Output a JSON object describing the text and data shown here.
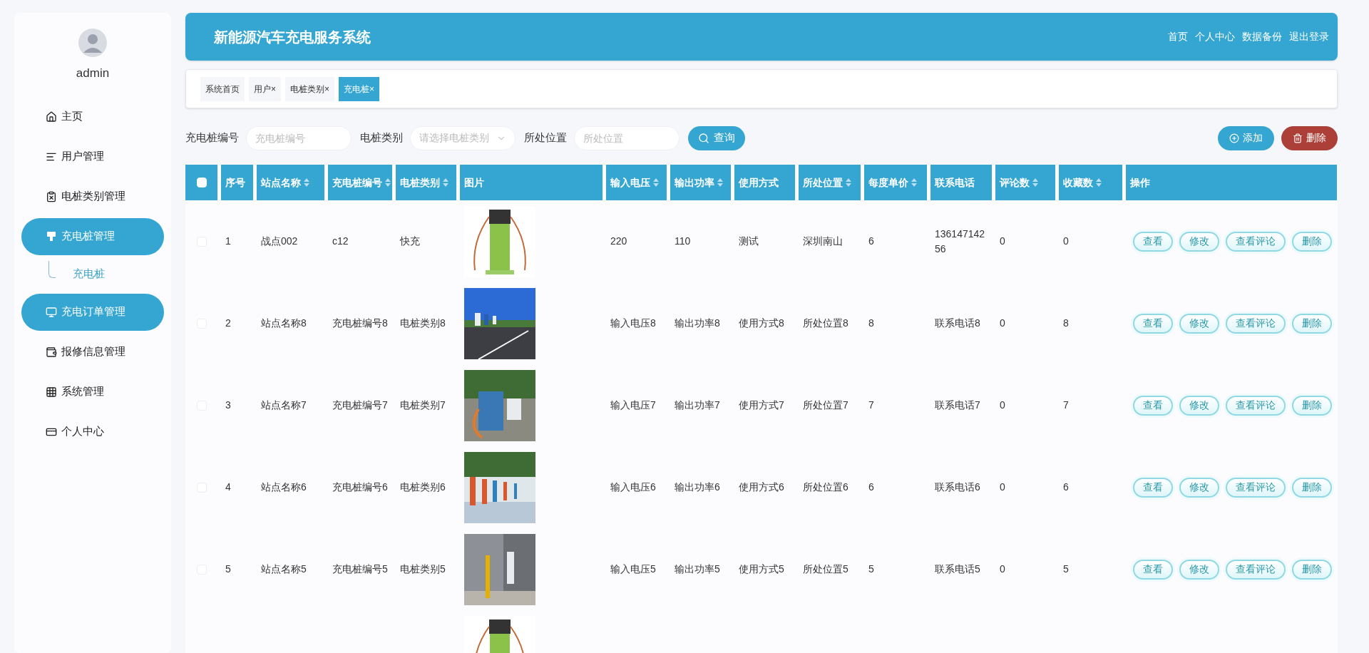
{
  "sidebar": {
    "user": "admin",
    "items": [
      {
        "label": "主页",
        "selected": false
      },
      {
        "label": "用户管理",
        "selected": false
      },
      {
        "label": "电桩类别管理",
        "selected": false
      },
      {
        "label": "充电桩管理",
        "selected": true,
        "children": [
          {
            "label": "充电桩",
            "selected": true
          }
        ]
      },
      {
        "label": "充电订单管理",
        "selected": true
      },
      {
        "label": "报修信息管理",
        "selected": false
      },
      {
        "label": "系统管理",
        "selected": false
      },
      {
        "label": "个人中心",
        "selected": false
      }
    ]
  },
  "header": {
    "title": "新能源汽车充电服务系统",
    "links": [
      "首页",
      "个人中心",
      "数据备份",
      "退出登录"
    ]
  },
  "tabs": [
    {
      "label": "系统首页",
      "selected": false
    },
    {
      "label": "用户",
      "close": "×",
      "selected": false
    },
    {
      "label": "电桩类别",
      "close": "×",
      "selected": false
    },
    {
      "label": "充电桩",
      "close": "×",
      "selected": true
    }
  ],
  "search": {
    "fields": [
      {
        "label": "充电桩编号",
        "kind": "input",
        "placeholder": "充电桩编号"
      },
      {
        "label": "电桩类别",
        "kind": "select",
        "placeholder": "请选择电桩类别"
      },
      {
        "label": "所处位置",
        "kind": "input",
        "placeholder": "所处位置"
      }
    ],
    "query_button": "查询",
    "add_button": "添加",
    "delete_button": "删除"
  },
  "table": {
    "select_all": {
      "checked": false
    },
    "columns": [
      {
        "label": "序号",
        "sortable": false
      },
      {
        "label": "站点名称",
        "sortable": true
      },
      {
        "label": "充电桩编号",
        "sortable": true
      },
      {
        "label": "电桩类别",
        "sortable": true
      },
      {
        "label": "图片",
        "sortable": false
      },
      {
        "label": "输入电压",
        "sortable": true
      },
      {
        "label": "输出功率",
        "sortable": true
      },
      {
        "label": "使用方式",
        "sortable": false
      },
      {
        "label": "所处位置",
        "sortable": true
      },
      {
        "label": "每度单价",
        "sortable": true
      },
      {
        "label": "联系电话",
        "sortable": false
      },
      {
        "label": "评论数",
        "sortable": true
      },
      {
        "label": "收藏数",
        "sortable": true
      },
      {
        "label": "操作",
        "sortable": false
      }
    ],
    "rows": [
      {
        "checked": false,
        "cells": [
          "1",
          "战点002",
          "c12",
          "快充",
          null,
          "220",
          "110",
          "测试",
          "深圳南山",
          "6",
          "13614714256",
          "0",
          "0"
        ],
        "actions": [
          "查看",
          "修改",
          "查看评论",
          "删除"
        ]
      },
      {
        "checked": false,
        "cells": [
          "2",
          "站点名称8",
          "充电桩编号8",
          "电桩类别8",
          null,
          "输入电压8",
          "输出功率8",
          "使用方式8",
          "所处位置8",
          "8",
          "联系电话8",
          "0",
          "8"
        ],
        "actions": [
          "查看",
          "修改",
          "查看评论",
          "删除"
        ]
      },
      {
        "checked": false,
        "cells": [
          "3",
          "站点名称7",
          "充电桩编号7",
          "电桩类别7",
          null,
          "输入电压7",
          "输出功率7",
          "使用方式7",
          "所处位置7",
          "7",
          "联系电话7",
          "0",
          "7"
        ],
        "actions": [
          "查看",
          "修改",
          "查看评论",
          "删除"
        ]
      },
      {
        "checked": false,
        "cells": [
          "4",
          "站点名称6",
          "充电桩编号6",
          "电桩类别6",
          null,
          "输入电压6",
          "输出功率6",
          "使用方式6",
          "所处位置6",
          "6",
          "联系电话6",
          "0",
          "6"
        ],
        "actions": [
          "查看",
          "修改",
          "查看评论",
          "删除"
        ]
      },
      {
        "checked": false,
        "cells": [
          "5",
          "站点名称5",
          "充电桩编号5",
          "电桩类别5",
          null,
          "输入电压5",
          "输出功率5",
          "使用方式5",
          "所处位置5",
          "5",
          "联系电话5",
          "0",
          "5"
        ],
        "actions": [
          "查看",
          "修改",
          "查看评论",
          "删除"
        ]
      }
    ]
  }
}
